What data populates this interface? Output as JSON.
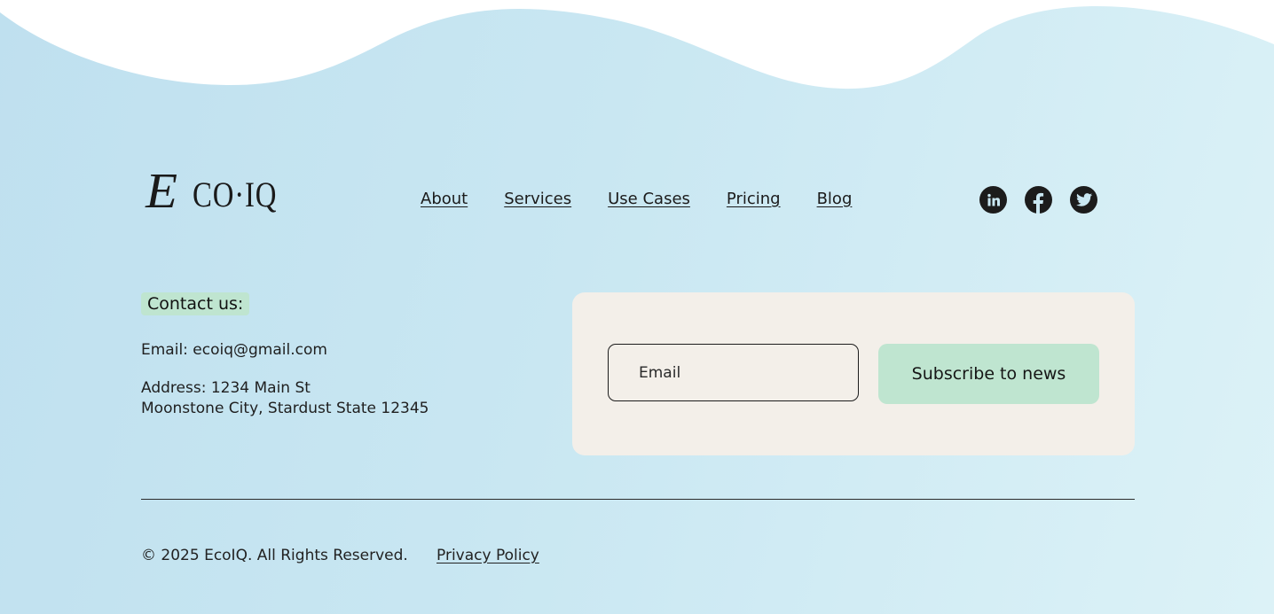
{
  "brand": {
    "logo_text": "ECO·IQ",
    "logo_initial": "E",
    "logo_rest": "CO·IQ"
  },
  "nav": {
    "items": [
      {
        "label": "About"
      },
      {
        "label": "Services"
      },
      {
        "label": "Use Cases"
      },
      {
        "label": "Pricing"
      },
      {
        "label": "Blog"
      }
    ]
  },
  "social": {
    "icons": [
      "linkedin-icon",
      "facebook-icon",
      "twitter-icon"
    ]
  },
  "contact": {
    "heading": "Contact us:",
    "email": "Email: ecoiq@gmail.com",
    "address_line1": "Address: 1234 Main St",
    "address_line2": "Moonstone City, Stardust State 12345"
  },
  "newsletter": {
    "email_placeholder": "Email",
    "button_label": "Subscribe to news"
  },
  "footer": {
    "copyright": "© 2025 EcoIQ. All Rights Reserved.",
    "privacy_label": "Privacy Policy"
  },
  "colors": {
    "accent_green": "#bfe5d0",
    "card_bg": "#f3efe9",
    "background_start": "#bfe0ef",
    "background_end": "#dcf2f7"
  }
}
